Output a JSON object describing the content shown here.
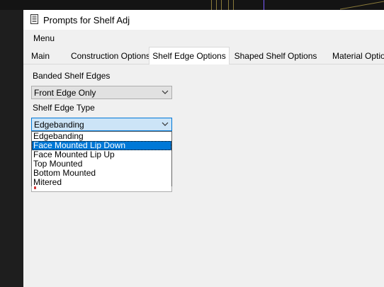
{
  "window": {
    "title": "Prompts for Shelf Adj"
  },
  "menu": {
    "items": [
      "Menu"
    ]
  },
  "tabs": [
    "Main",
    "Construction Options",
    "Shelf Edge Options",
    "Shaped Shelf Options",
    "Material Options"
  ],
  "active_tab_index": 2,
  "fields": {
    "banded_label": "Banded Shelf Edges",
    "banded_value": "Front Edge Only",
    "type_label": "Shelf Edge Type",
    "type_value": "Edgebanding"
  },
  "dropdown": {
    "options": [
      "Edgebanding",
      "Face Mounted Lip Down",
      "Face Mounted Lip Up",
      "Top Mounted",
      "Bottom Mounted",
      "Mitered"
    ],
    "highlighted_index": 1
  },
  "colors": {
    "selection": "#0078d7",
    "open_combo": "#cce4f7",
    "window_bg": "#f0f0f0",
    "desktop_bg": "#1e1e1e"
  },
  "icons": [
    "app-icon",
    "chevron-down-icon"
  ]
}
